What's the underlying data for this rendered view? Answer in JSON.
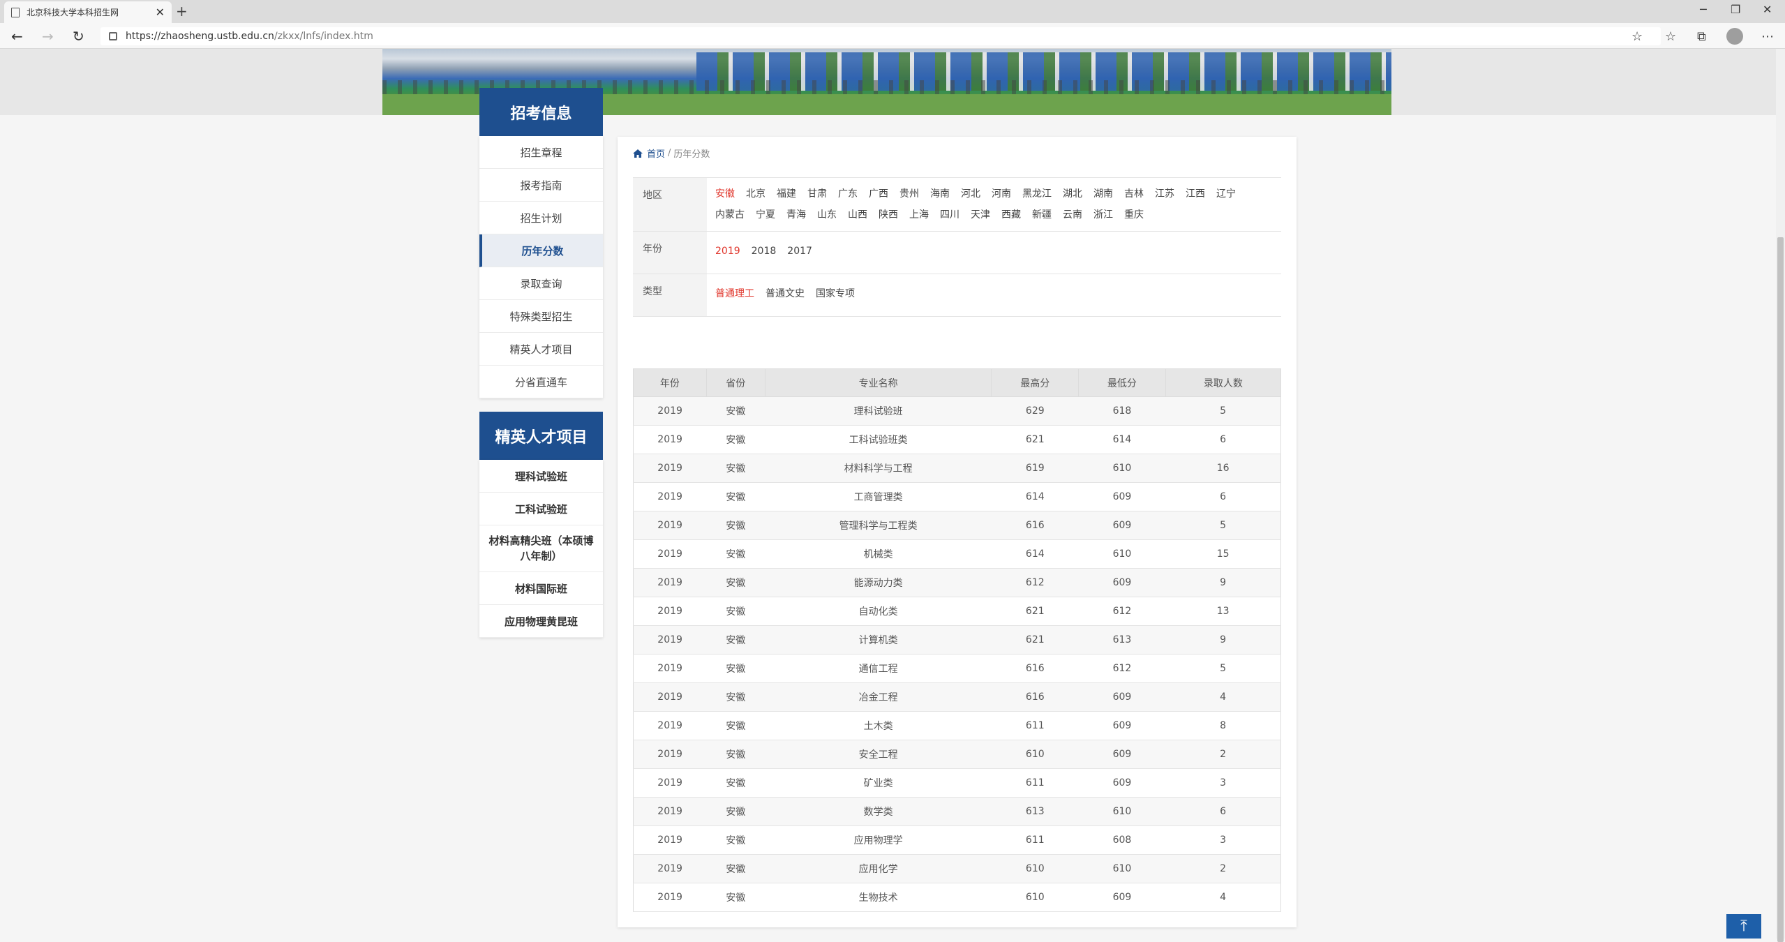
{
  "browser": {
    "tab_title": "北京科技大学本科招生网",
    "tab_close": "✕",
    "new_tab": "+",
    "url_main": "https://zhaosheng.ustb.edu.cn",
    "url_rest": "/zkxx/lnfs/index.htm",
    "window_controls": {
      "minimize": "─",
      "restore": "❐",
      "close": "✕"
    },
    "nav": {
      "back": "←",
      "forward": "→",
      "refresh": "↻"
    },
    "toolbar": {
      "favorite": "☆",
      "favorites": "☆",
      "collections": "⧉",
      "more": "⋯"
    }
  },
  "sidebar": {
    "title": "招考信息",
    "items": [
      "招生章程",
      "报考指南",
      "招生计划",
      "历年分数",
      "录取查询",
      "特殊类型招生",
      "精英人才项目",
      "分省直通车"
    ],
    "active_index": 3
  },
  "sidebar2": {
    "title": "精英人才项目",
    "items": [
      "理科试验班",
      "工科试验班",
      "材料高精尖班（本硕博八年制）",
      "材料国际班",
      "应用物理黄昆班"
    ]
  },
  "breadcrumb": {
    "home": "首页",
    "sep": "/",
    "current": "历年分数"
  },
  "filters": {
    "region_label": "地区",
    "regions": [
      "安徽",
      "北京",
      "福建",
      "甘肃",
      "广东",
      "广西",
      "贵州",
      "海南",
      "河北",
      "河南",
      "黑龙江",
      "湖北",
      "湖南",
      "吉林",
      "江苏",
      "江西",
      "辽宁",
      "内蒙古",
      "宁夏",
      "青海",
      "山东",
      "山西",
      "陕西",
      "上海",
      "四川",
      "天津",
      "西藏",
      "新疆",
      "云南",
      "浙江",
      "重庆"
    ],
    "region_selected": "安徽",
    "year_label": "年份",
    "years": [
      "2019",
      "2018",
      "2017"
    ],
    "year_selected": "2019",
    "type_label": "类型",
    "types": [
      "普通理工",
      "普通文史",
      "国家专项"
    ],
    "type_selected": "普通理工"
  },
  "table": {
    "headers": [
      "年份",
      "省份",
      "专业名称",
      "最高分",
      "最低分",
      "录取人数"
    ],
    "rows": [
      [
        "2019",
        "安徽",
        "理科试验班",
        "629",
        "618",
        "5"
      ],
      [
        "2019",
        "安徽",
        "工科试验班类",
        "621",
        "614",
        "6"
      ],
      [
        "2019",
        "安徽",
        "材料科学与工程",
        "619",
        "610",
        "16"
      ],
      [
        "2019",
        "安徽",
        "工商管理类",
        "614",
        "609",
        "6"
      ],
      [
        "2019",
        "安徽",
        "管理科学与工程类",
        "616",
        "609",
        "5"
      ],
      [
        "2019",
        "安徽",
        "机械类",
        "614",
        "610",
        "15"
      ],
      [
        "2019",
        "安徽",
        "能源动力类",
        "612",
        "609",
        "9"
      ],
      [
        "2019",
        "安徽",
        "自动化类",
        "621",
        "612",
        "13"
      ],
      [
        "2019",
        "安徽",
        "计算机类",
        "621",
        "613",
        "9"
      ],
      [
        "2019",
        "安徽",
        "通信工程",
        "616",
        "612",
        "5"
      ],
      [
        "2019",
        "安徽",
        "冶金工程",
        "616",
        "609",
        "4"
      ],
      [
        "2019",
        "安徽",
        "土木类",
        "611",
        "609",
        "8"
      ],
      [
        "2019",
        "安徽",
        "安全工程",
        "610",
        "609",
        "2"
      ],
      [
        "2019",
        "安徽",
        "矿业类",
        "611",
        "609",
        "3"
      ],
      [
        "2019",
        "安徽",
        "数学类",
        "613",
        "610",
        "6"
      ],
      [
        "2019",
        "安徽",
        "应用物理学",
        "611",
        "608",
        "3"
      ],
      [
        "2019",
        "安徽",
        "应用化学",
        "610",
        "610",
        "2"
      ],
      [
        "2019",
        "安徽",
        "生物技术",
        "610",
        "609",
        "4"
      ]
    ]
  },
  "back_to_top": "⤒"
}
